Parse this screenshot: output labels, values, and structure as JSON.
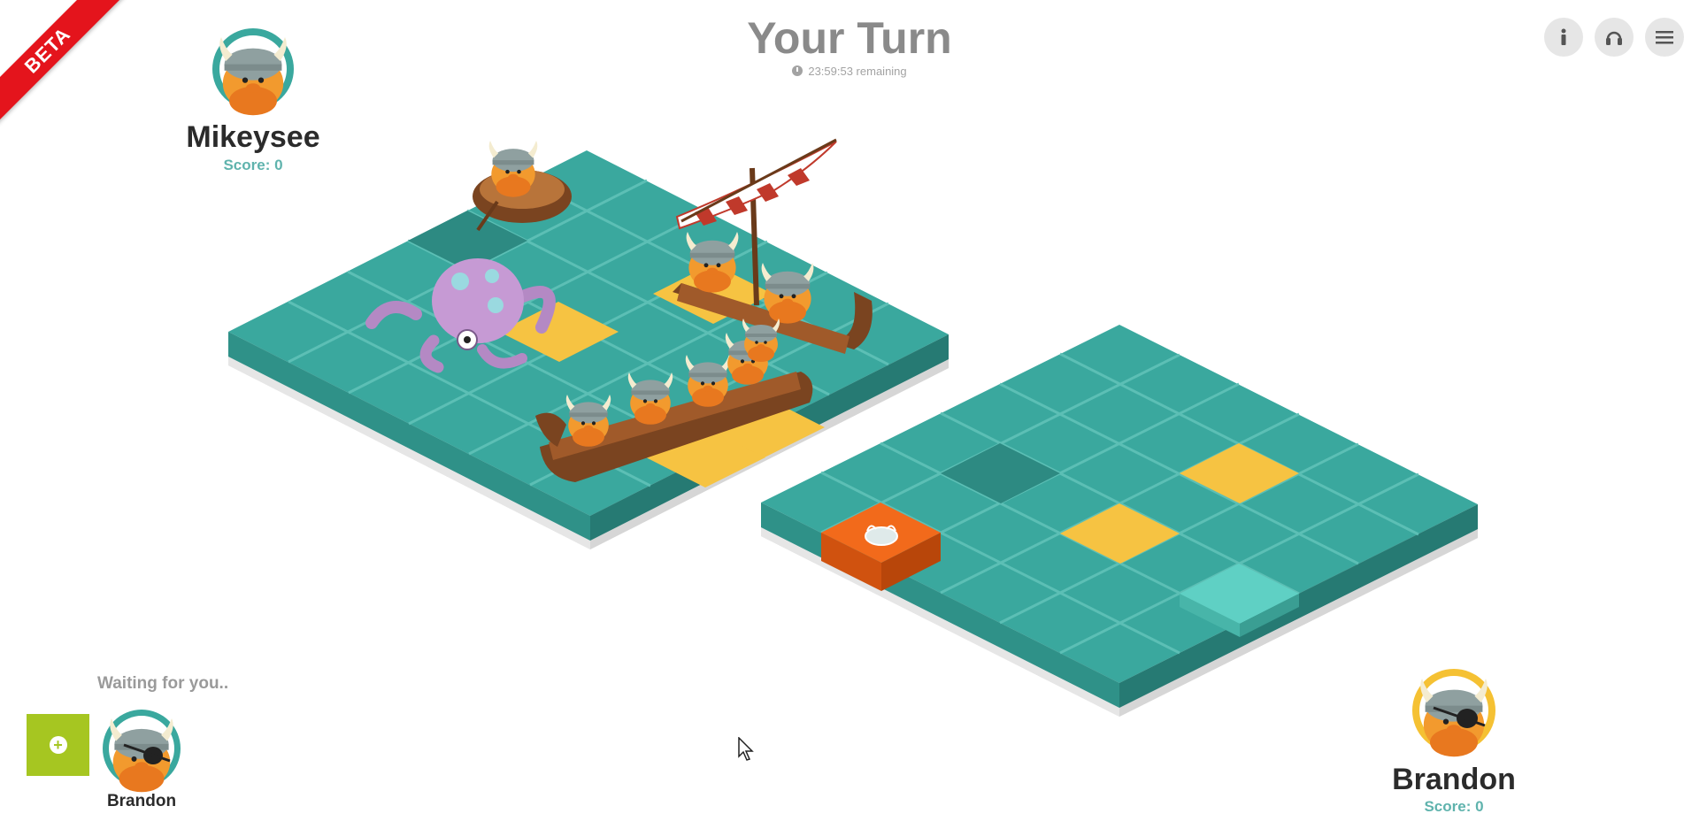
{
  "banner": {
    "label": "BETA"
  },
  "header": {
    "title": "Your Turn",
    "timer": "23:59:53 remaining"
  },
  "toolbar": {
    "info_icon": "info-icon",
    "audio_icon": "headphones-icon",
    "menu_icon": "hamburger-menu-icon"
  },
  "opponent": {
    "name": "Mikeysee",
    "score": "Score: 0",
    "ring_color": "#3aa89e"
  },
  "player": {
    "name": "Brandon",
    "score": "Score: 0",
    "ring_color": "#f5c133"
  },
  "lobby": {
    "status": "Waiting for you..",
    "add_icon": "plus-circle-icon",
    "name": "Brandon",
    "ring_color": "#3aa89e"
  },
  "colors": {
    "tile": "#3aa89e",
    "tile_dark": "#2d8a82",
    "highlight": "#f6c342",
    "hit": "#f26a1b",
    "selected": "#5fd0c4",
    "base": "#e8e8e8"
  }
}
